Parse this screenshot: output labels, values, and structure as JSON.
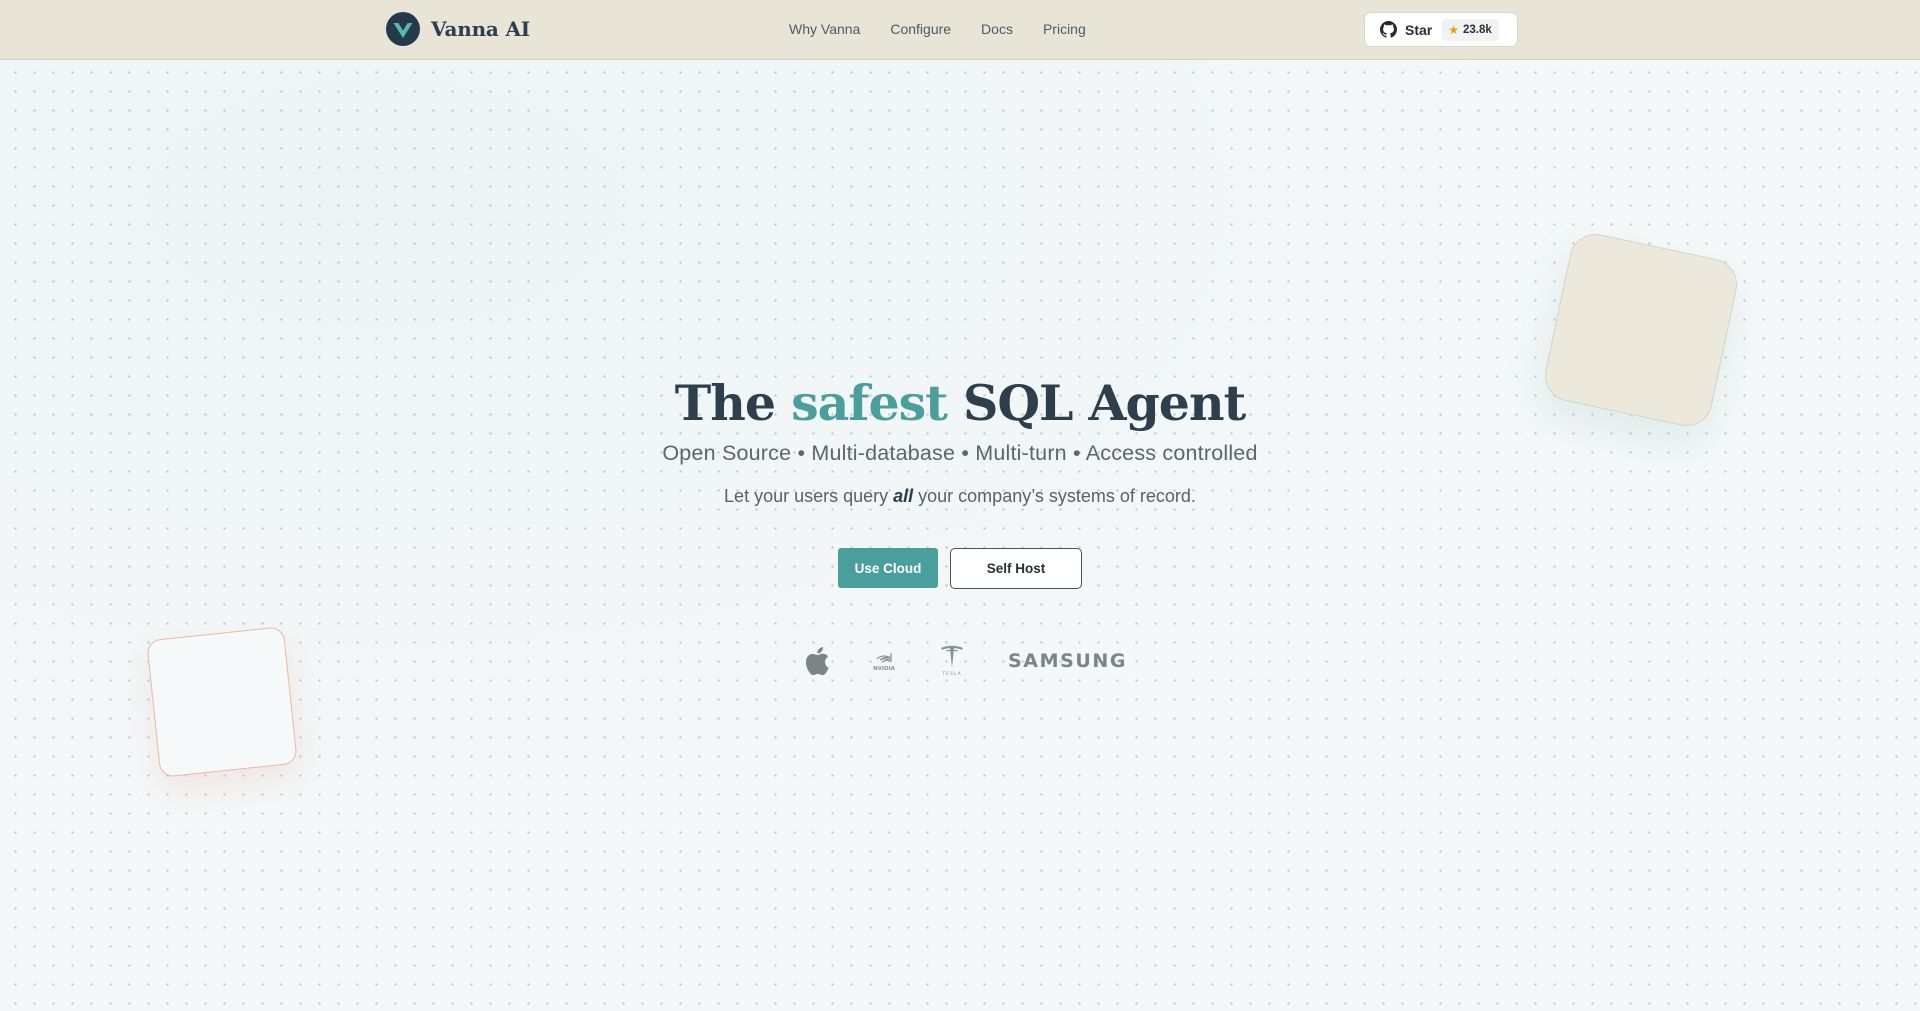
{
  "header": {
    "brand_name": "Vanna AI",
    "nav": [
      "Why Vanna",
      "Configure",
      "Docs",
      "Pricing"
    ],
    "github": {
      "label": "Star",
      "count": "23.8k"
    }
  },
  "hero": {
    "title_before": "The ",
    "title_accent": "safest",
    "title_after": " SQL Agent",
    "features": "Open Source • Multi-database • Multi-turn • Access controlled",
    "tagline_before": "Let your users query ",
    "tagline_emphasis": "all",
    "tagline_after": " your company’s systems of record.",
    "primary_button": "Use Cloud",
    "secondary_button": "Self Host"
  },
  "logos": [
    {
      "name": "Apple",
      "icon": "apple-icon"
    },
    {
      "name": "NVIDIA",
      "icon": "nvidia-icon"
    },
    {
      "name": "TESLA",
      "icon": "tesla-icon"
    },
    {
      "name": "SAMSUNG",
      "icon": "samsung-wordmark"
    }
  ],
  "colors": {
    "accent": "#4a9e9c",
    "heading": "#2d3f4d",
    "header_bg": "#e8e4d6",
    "star": "#e2a400"
  }
}
